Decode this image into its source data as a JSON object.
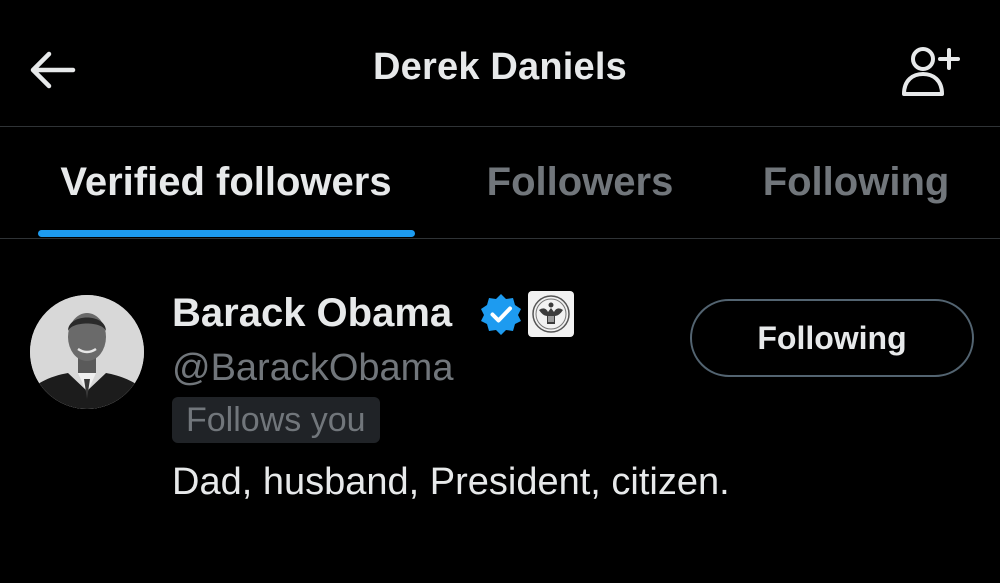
{
  "header": {
    "title": "Derek Daniels",
    "back_icon": "arrow-left-icon",
    "add_user_icon": "add-user-icon"
  },
  "tabs": [
    {
      "label": "Verified followers",
      "active": true
    },
    {
      "label": "Followers",
      "active": false
    },
    {
      "label": "Following",
      "active": false
    }
  ],
  "user": {
    "name": "Barack Obama",
    "handle": "@BarackObama",
    "follows_you": "Follows you",
    "bio": "Dad, husband, President, citizen.",
    "verified_icon": "verified-badge-icon",
    "affiliation_icon": "government-seal-icon",
    "button_label": "Following"
  },
  "colors": {
    "background": "#000000",
    "text_primary": "#e7e9ea",
    "text_secondary": "#71767b",
    "accent": "#1d9bf0",
    "divider": "#2f3336"
  }
}
